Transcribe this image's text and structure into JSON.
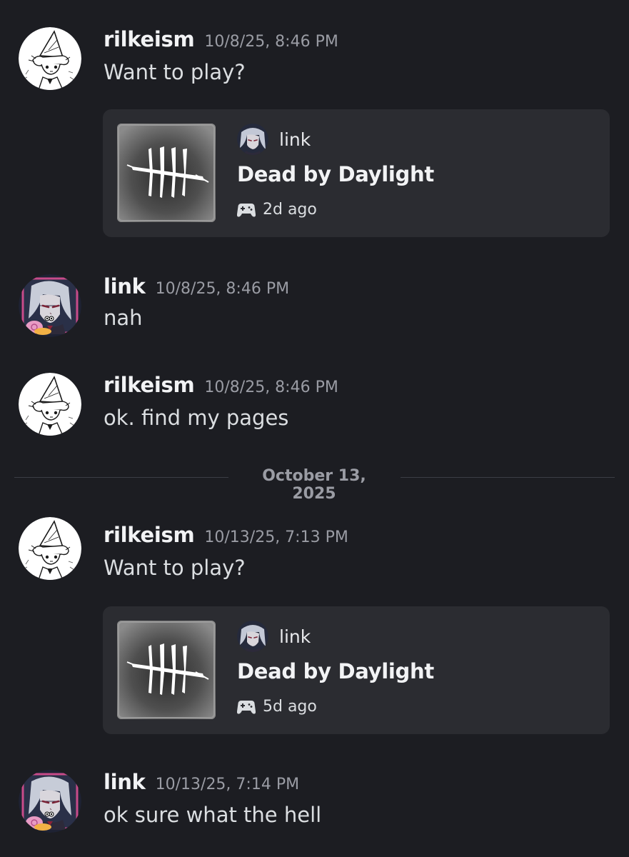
{
  "messages": [
    {
      "author": "rilkeism",
      "timestamp": "10/8/25, 8:46 PM",
      "text": "Want to play?",
      "card": {
        "user": "link",
        "title": "Dead by Daylight",
        "meta": "2d ago"
      }
    },
    {
      "author": "link",
      "timestamp": "10/8/25, 8:46 PM",
      "text": "nah"
    },
    {
      "author": "rilkeism",
      "timestamp": "10/8/25, 8:46 PM",
      "text": "ok. find my pages"
    },
    {
      "author": "rilkeism",
      "timestamp": "10/13/25, 7:13 PM",
      "text": "Want to play?",
      "card": {
        "user": "link",
        "title": "Dead by Daylight",
        "meta": "5d ago"
      }
    },
    {
      "author": "link",
      "timestamp": "10/13/25, 7:14 PM",
      "text": "ok sure what the hell"
    }
  ],
  "date_divider": "October 13, 2025",
  "icons": {
    "game": "gamepad-icon",
    "thumbnail": "dead-by-daylight-logo",
    "avatar_rilkeism": "gnome-hat-avatar",
    "avatar_link": "anime-girl-avatar"
  },
  "colors": {
    "background": "#1c1d22",
    "card": "#2b2c31",
    "username": "#f2f3f5",
    "timestamp": "#9a9ca4",
    "avatar_link_border": "#c84b8a"
  }
}
